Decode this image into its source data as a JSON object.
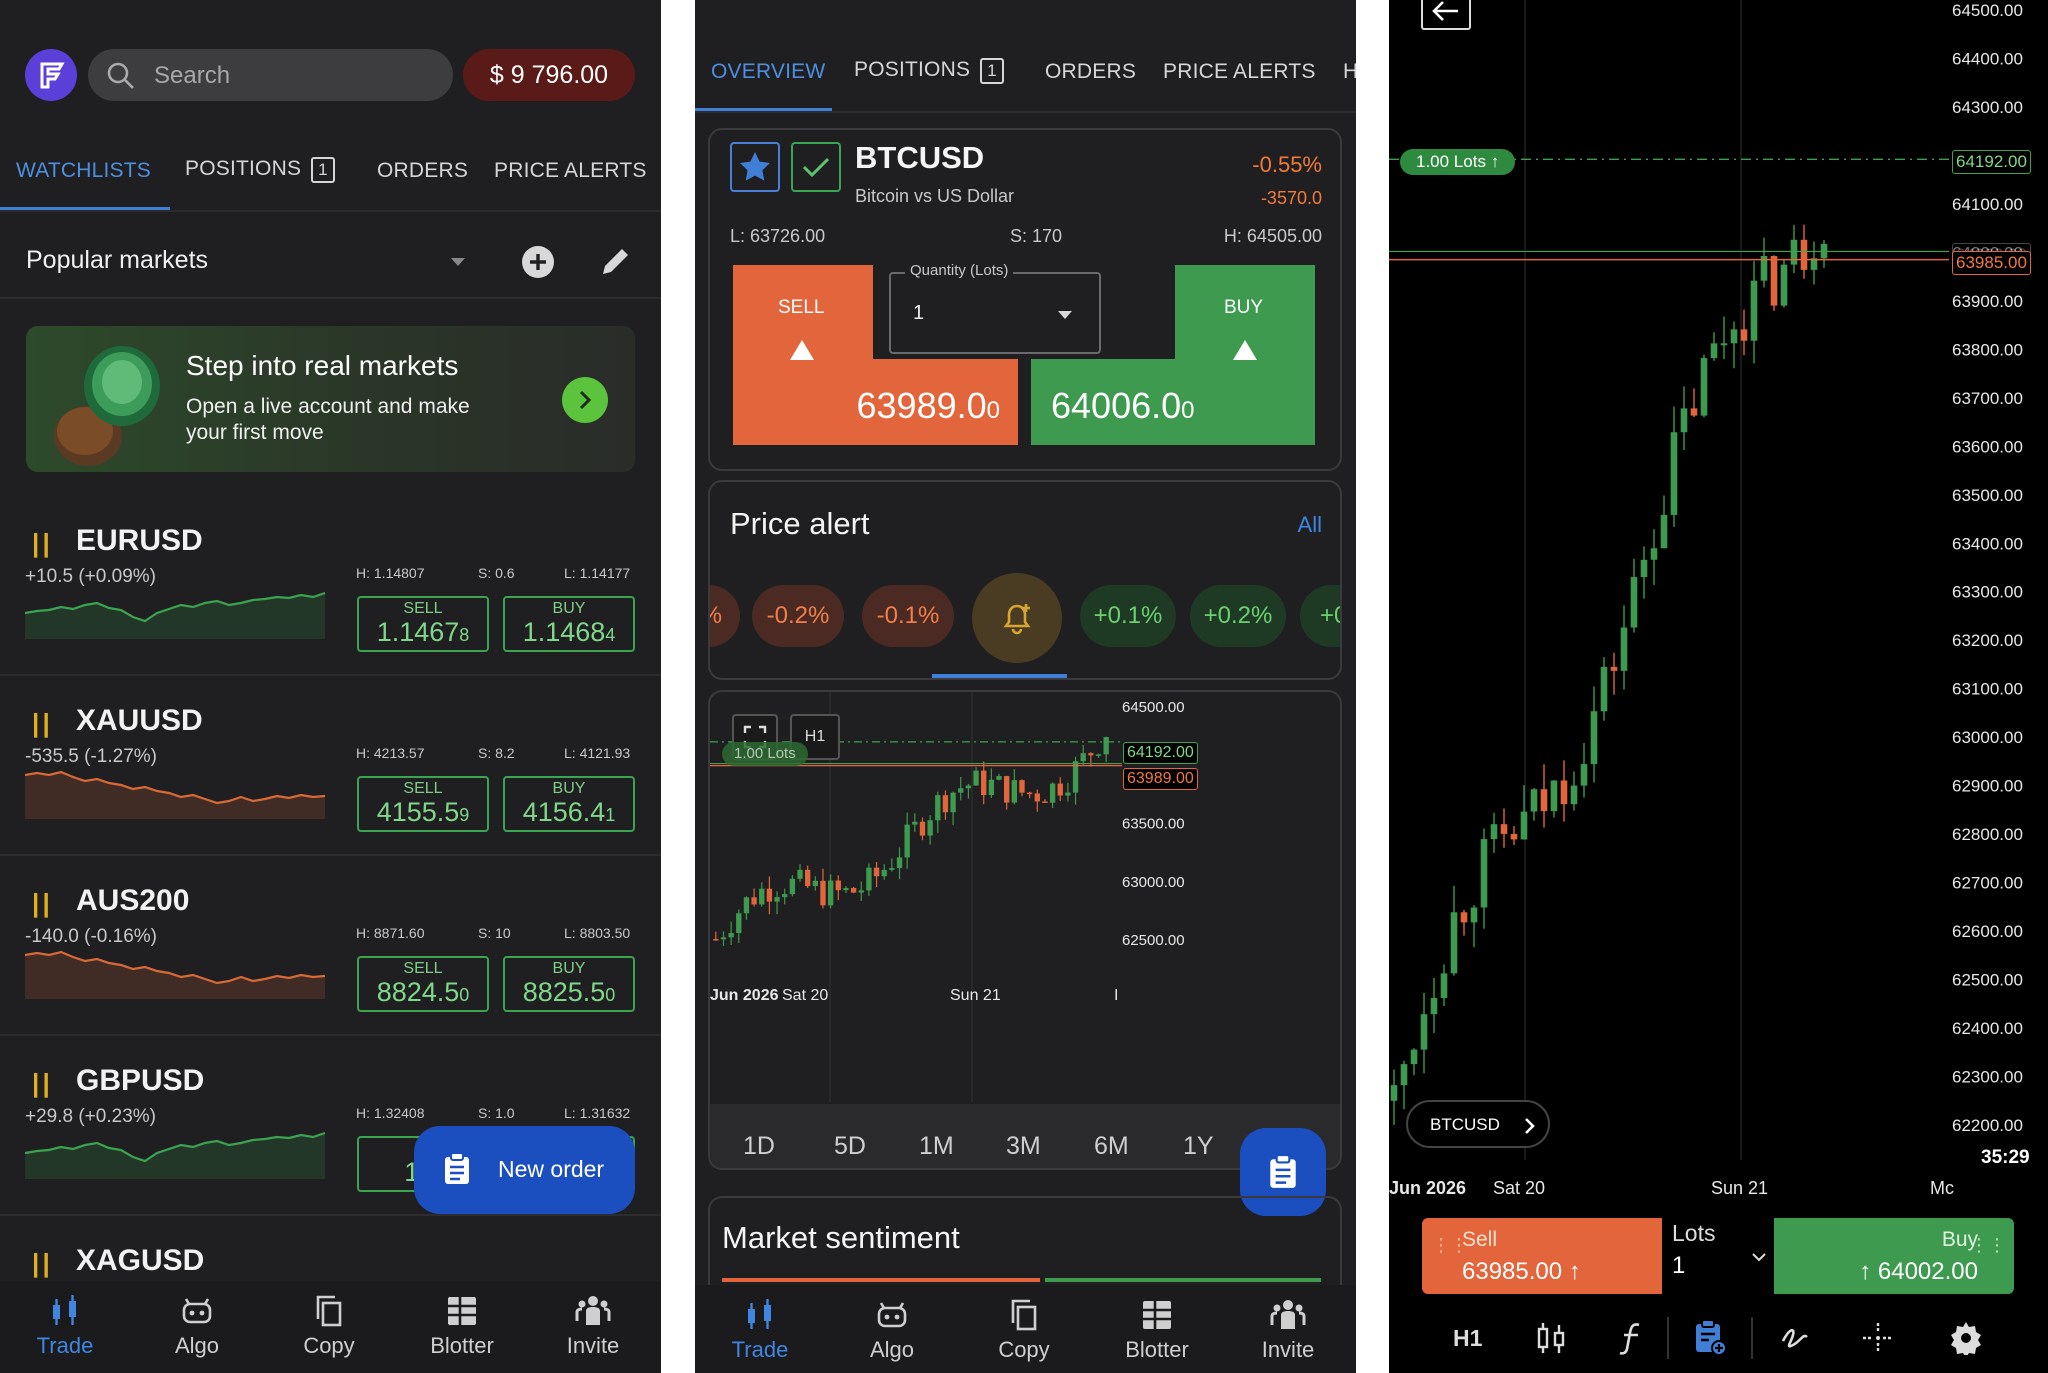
{
  "watchlist_screen": {
    "search_placeholder": "Search",
    "balance": "$ 9 796.00",
    "tabs": [
      {
        "label": "WATCHLISTS"
      },
      {
        "label": "POSITIONS",
        "badge": "1"
      },
      {
        "label": "ORDERS"
      },
      {
        "label": "PRICE ALERTS"
      }
    ],
    "list_name": "Popular markets",
    "promo": {
      "title": "Step into real markets",
      "body": "Open a live account and make your first move"
    },
    "markets": [
      {
        "symbol": "EURUSD",
        "change": "+10.5 (+0.09%)",
        "high": "H: 1.14807",
        "spread": "S: 0.6",
        "low": "L: 1.14177",
        "sell_label": "SELL",
        "sell_main": "1.1467",
        "sell_small": "8",
        "buy_label": "BUY",
        "buy_main": "1.1468",
        "buy_small": "4",
        "trend": "up"
      },
      {
        "symbol": "XAUUSD",
        "change": "-535.5 (-1.27%)",
        "high": "H: 4213.57",
        "spread": "S: 8.2",
        "low": "L: 4121.93",
        "sell_label": "SELL",
        "sell_main": "4155.5",
        "sell_small": "9",
        "buy_label": "BUY",
        "buy_main": "4156.4",
        "buy_small": "1",
        "trend": "down"
      },
      {
        "symbol": "AUS200",
        "change": "-140.0 (-0.16%)",
        "high": "H: 8871.60",
        "spread": "S: 10",
        "low": "L: 8803.50",
        "sell_label": "SELL",
        "sell_main": "8824.5",
        "sell_small": "0",
        "buy_label": "BUY",
        "buy_main": "8825.5",
        "buy_small": "0",
        "trend": "down"
      },
      {
        "symbol": "GBPUSD",
        "change": "+29.8 (+0.23%)",
        "high": "H: 1.32408",
        "spread": "S: 1.0",
        "low": "L: 1.31632",
        "sell_label": "S",
        "sell_main": "1.3",
        "sell_small": "",
        "buy_label": "",
        "buy_main": "",
        "buy_small": "",
        "trend": "up"
      },
      {
        "symbol": "XAGUSD"
      }
    ],
    "new_order": "New order",
    "nav": [
      "Trade",
      "Algo",
      "Copy",
      "Blotter",
      "Invite"
    ]
  },
  "detail_screen": {
    "tabs": [
      {
        "label": "OVERVIEW"
      },
      {
        "label": "POSITIONS",
        "badge": "1"
      },
      {
        "label": "ORDERS"
      },
      {
        "label": "PRICE ALERTS"
      },
      {
        "label": "H"
      }
    ],
    "symbol": "BTCUSD",
    "description": "Bitcoin vs US Dollar",
    "change_pct": "-0.55%",
    "change_abs": "-3570.0",
    "low": "L: 63726.00",
    "spread": "S: 170",
    "high": "H: 64505.00",
    "sell_label": "SELL",
    "sell_main": "63989.0",
    "sell_small": "0",
    "buy_label": "BUY",
    "buy_main": "64006.0",
    "buy_small": "0",
    "qty_label": "Quantity (Lots)",
    "qty_value": "1",
    "price_alert_title": "Price alert",
    "price_alert_all": "All",
    "alert_pills": [
      "%",
      "-0.2%",
      "-0.1%",
      "+0.1%",
      "+0.2%",
      "+0"
    ],
    "chart": {
      "interval": "H1",
      "lots_tag": "1.00 Lots",
      "line_green": "64192.00",
      "line_red": "63989.00",
      "y_labels": [
        "64500.00",
        "63500.00",
        "63000.00",
        "62500.00"
      ],
      "x_labels": [
        "Jun 2026",
        "Sat 20",
        "Sun 21",
        "I"
      ]
    },
    "timeframes": [
      "1D",
      "5D",
      "1M",
      "3M",
      "6M",
      "1Y"
    ],
    "sentiment_title": "Market sentiment",
    "nav": [
      "Trade",
      "Algo",
      "Copy",
      "Blotter",
      "Invite"
    ]
  },
  "chart_screen": {
    "lots_tag": "1.00 Lots",
    "line_green": "64192.00",
    "line_red": "63985.00",
    "line_gray": "64000.00",
    "y_labels": [
      "64500.00",
      "64400.00",
      "64300.00",
      "64200.00",
      "64100.00",
      "64000.00",
      "63900.00",
      "63800.00",
      "63700.00",
      "63600.00",
      "63500.00",
      "63400.00",
      "63300.00",
      "63200.00",
      "63100.00",
      "63000.00",
      "62900.00",
      "62800.00",
      "62700.00",
      "62600.00",
      "62500.00",
      "62400.00",
      "62300.00",
      "62200.00"
    ],
    "countdown": "35:29",
    "x_labels": [
      "Jun 2026",
      "Sat 20",
      "Sun 21",
      "Mc"
    ],
    "symbol_chip": "BTCUSD",
    "sell_label": "Sell",
    "sell_price": "63985.00",
    "lots_label": "Lots",
    "lots_value": "1",
    "buy_label": "Buy",
    "buy_price": "64002.00",
    "toolbar_interval": "H1"
  },
  "colors": {
    "accent": "#3f7fd6",
    "sell": "#e0653a",
    "buy": "#3f9a4f",
    "warn": "#e0b020"
  }
}
